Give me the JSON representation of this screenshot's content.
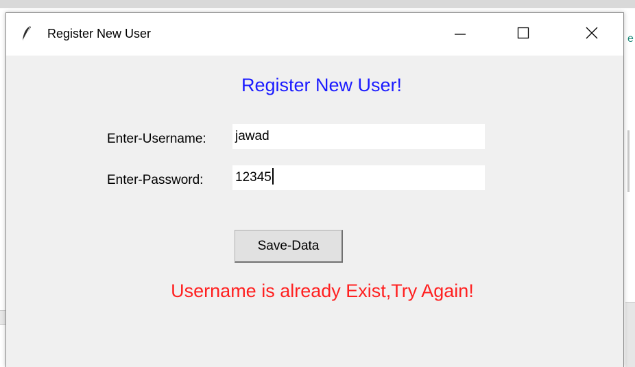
{
  "window": {
    "title": "Register New User",
    "controls": {
      "minimize": "minimize-icon",
      "maximize": "maximize-icon",
      "close": "close-icon"
    }
  },
  "form": {
    "heading": "Register New User!",
    "heading_color": "#1a1aff",
    "username_label": "Enter-Username:",
    "username_value": "jawad",
    "password_label": "Enter-Password:",
    "password_value": "12345",
    "save_label": "Save-Data"
  },
  "status": {
    "message": "Username is already Exist,Try Again!",
    "color": "#ff2020"
  },
  "background": {
    "peek_char": "e"
  }
}
